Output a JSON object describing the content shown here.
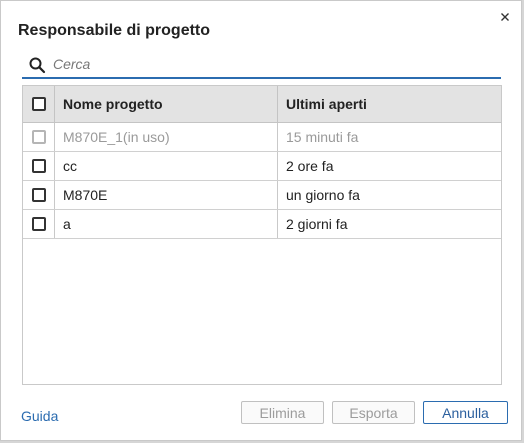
{
  "dialog": {
    "title": "Responsabile di progetto",
    "search_placeholder": "Cerca",
    "search_value": ""
  },
  "table": {
    "headers": {
      "name": "Nome progetto",
      "opened": "Ultimi aperti"
    },
    "rows": [
      {
        "name": "M870E_1(in uso)",
        "opened": "15 minuti fa",
        "disabled": true,
        "checked": false
      },
      {
        "name": "cc",
        "opened": "2 ore fa",
        "disabled": false,
        "checked": false
      },
      {
        "name": "M870E",
        "opened": "un giorno fa",
        "disabled": false,
        "checked": false
      },
      {
        "name": "a",
        "opened": "2 giorni fa",
        "disabled": false,
        "checked": false
      }
    ]
  },
  "footer": {
    "help_label": "Guida",
    "delete_label": "Elimina",
    "export_label": "Esporta",
    "cancel_label": "Annulla"
  },
  "colors": {
    "accent": "#2b6cb0",
    "disabled_text": "#9a9a9a",
    "header_bg": "#e3e3e3"
  },
  "icons": {
    "close": "close-icon",
    "search": "search-icon",
    "checkbox": "checkbox-icon"
  }
}
